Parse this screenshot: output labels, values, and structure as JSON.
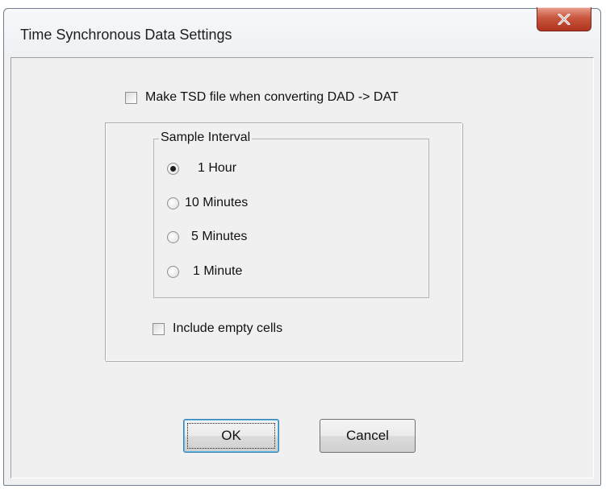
{
  "window": {
    "title": "Time Synchronous Data Settings",
    "close_glyph": "✕"
  },
  "make_tsd": {
    "label": "Make TSD file when converting DAD -> DAT",
    "checked": false
  },
  "sample_interval": {
    "legend": "Sample Interval",
    "options": [
      {
        "label": "1 Hour",
        "selected": true
      },
      {
        "label": "10 Minutes",
        "selected": false
      },
      {
        "label": "5 Minutes",
        "selected": false
      },
      {
        "label": "1 Minute",
        "selected": false
      }
    ]
  },
  "include_empty": {
    "label": "Include empty cells",
    "checked": false
  },
  "buttons": {
    "ok_label": "OK",
    "cancel_label": "Cancel"
  },
  "colors": {
    "close_button": "#c9573f",
    "default_button_border": "#3c7fb1"
  }
}
